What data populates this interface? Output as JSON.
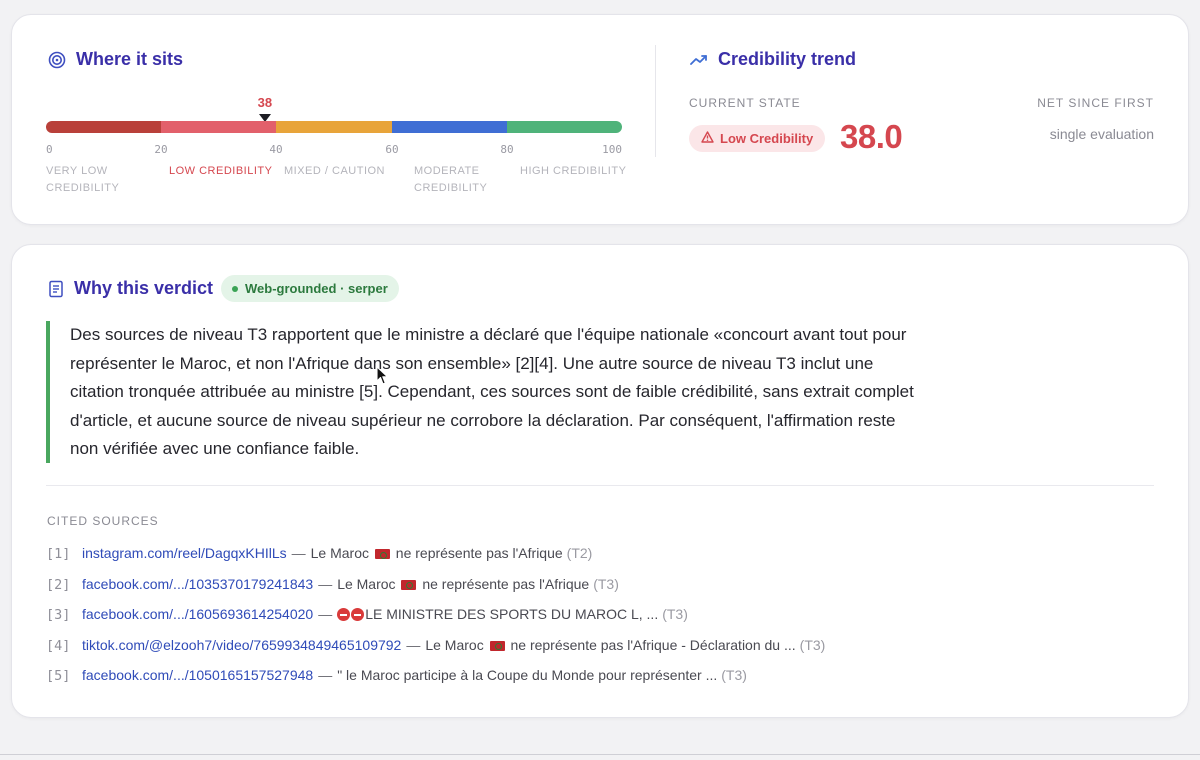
{
  "where_it_sits": {
    "title": "Where it sits",
    "score": 38,
    "score_label": "38",
    "scale_max": 100,
    "ticks": [
      "0",
      "20",
      "40",
      "60",
      "80",
      "100"
    ],
    "bands": [
      {
        "label": "VERY LOW CREDIBILITY",
        "color": "#b9403a"
      },
      {
        "label": "LOW CREDIBILITY",
        "color": "#e2606b"
      },
      {
        "label": "MIXED / CAUTION",
        "color": "#e8a43a"
      },
      {
        "label": "MODERATE CREDIBILITY",
        "color": "#3f6ed4"
      },
      {
        "label": "HIGH CREDIBILITY",
        "color": "#4fb37a"
      }
    ],
    "active_band": 1
  },
  "credibility_trend": {
    "title": "Credibility trend",
    "current_state_label": "CURRENT STATE",
    "net_since_label": "NET SINCE FIRST",
    "badge_label": "Low Credibility",
    "score_value": "38.0",
    "net_value": "single evaluation"
  },
  "verdict": {
    "title": "Why this verdict",
    "chip_label": "Web-grounded · serper",
    "text": "Des sources de niveau T3 rapportent que le ministre a déclaré que l'équipe nationale «concourt avant tout pour représenter le Maroc, et non l'Afrique dans son ensemble» [2][4]. Une autre source de niveau T3 inclut une citation tronquée attribuée au ministre [5]. Cependant, ces sources sont de faible crédibilité, sans extrait complet d'article, et aucune source de niveau supérieur ne corrobore la déclaration. Par conséquent, l'affirmation reste non vérifiée avec une confiance faible.",
    "cited_label": "CITED SOURCES",
    "sources": [
      {
        "num": "[1]",
        "link": "instagram.com/reel/DagqxKHIlLs",
        "sep": "—",
        "pre": "Le Maroc",
        "icon": "morocco-flag",
        "post": "ne représente pas l'Afrique",
        "tier": "(T2)"
      },
      {
        "num": "[2]",
        "link": "facebook.com/.../1035370179241843",
        "sep": "—",
        "pre": "Le Maroc",
        "icon": "morocco-flag",
        "post": "ne représente pas l'Afrique",
        "tier": "(T3)"
      },
      {
        "num": "[3]",
        "link": "facebook.com/.../1605693614254020",
        "sep": "—",
        "pre": "",
        "icon": "no-entry-emoji",
        "post": "LE MINISTRE DES SPORTS DU MAROC L, ...",
        "tier": "(T3)"
      },
      {
        "num": "[4]",
        "link": "tiktok.com/@elzooh7/video/7659934849465109792",
        "sep": "—",
        "pre": "Le Maroc",
        "icon": "morocco-flag",
        "post": "ne représente pas l'Afrique - Déclaration du ...",
        "tier": "(T3)"
      },
      {
        "num": "[5]",
        "link": "facebook.com/.../1050165157527948",
        "sep": "—",
        "pre": "\" le Maroc participe à la Coupe du Monde pour représenter ...",
        "icon": "",
        "post": "",
        "tier": "(T3)"
      }
    ]
  },
  "colors": {
    "accent_title": "#3a2fa8",
    "low_red": "#d5474f",
    "grounded_green": "#2c7a3e",
    "link_blue": "#2f4bb8"
  }
}
